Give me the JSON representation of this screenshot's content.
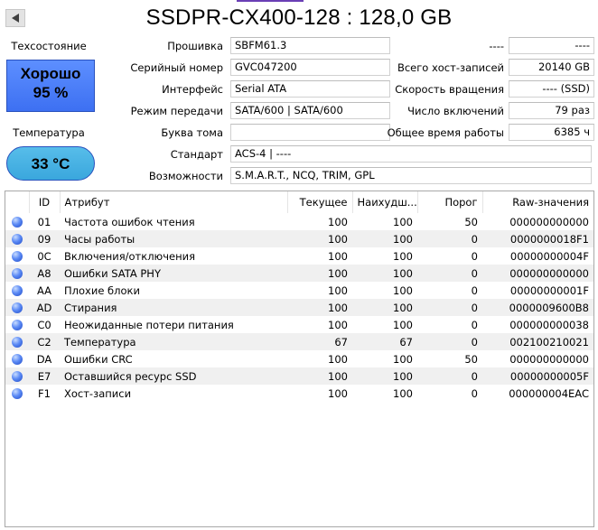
{
  "title": "SSDPR-CX400-128 : 128,0 GB",
  "health": {
    "label": "Техсостояние",
    "status": "Хорошо",
    "percent": "95 %",
    "color": "#4a7df7"
  },
  "temperature": {
    "label": "Температура",
    "value": "33 °C",
    "color": "#45b0e0"
  },
  "fields_left": [
    {
      "label": "Прошивка",
      "value": "SBFM61.3"
    },
    {
      "label": "Серийный номер",
      "value": "GVC047200"
    },
    {
      "label": "Интерфейс",
      "value": "Serial ATA"
    },
    {
      "label": "Режим передачи",
      "value": "SATA/600 | SATA/600"
    },
    {
      "label": "Буква тома",
      "value": ""
    },
    {
      "label": "Стандарт",
      "value": "ACS-4 | ----"
    },
    {
      "label": "Возможности",
      "value": "S.M.A.R.T., NCQ, TRIM, GPL"
    }
  ],
  "fields_right": [
    {
      "label": "----",
      "value": "----"
    },
    {
      "label": "Всего хост-записей",
      "value": "20140 GB"
    },
    {
      "label": "Скорость вращения",
      "value": "---- (SSD)"
    },
    {
      "label": "Число включений",
      "value": "79 раз"
    },
    {
      "label": "Общее время работы",
      "value": "6385 ч"
    }
  ],
  "smart": {
    "headers": [
      "",
      "ID",
      "Атрибут",
      "Текущее",
      "Наихудш...",
      "Порог",
      "Raw-значения"
    ],
    "rows": [
      [
        "01",
        "Частота ошибок чтения",
        "100",
        "100",
        "50",
        "000000000000"
      ],
      [
        "09",
        "Часы работы",
        "100",
        "100",
        "0",
        "0000000018F1"
      ],
      [
        "0C",
        "Включения/отключения",
        "100",
        "100",
        "0",
        "00000000004F"
      ],
      [
        "A8",
        "Ошибки SATA PHY",
        "100",
        "100",
        "0",
        "000000000000"
      ],
      [
        "AA",
        "Плохие блоки",
        "100",
        "100",
        "0",
        "00000000001F"
      ],
      [
        "AD",
        "Стирания",
        "100",
        "100",
        "0",
        "0000009600B8"
      ],
      [
        "C0",
        "Неожиданные потери питания",
        "100",
        "100",
        "0",
        "000000000038"
      ],
      [
        "C2",
        "Температура",
        "67",
        "67",
        "0",
        "002100210021"
      ],
      [
        "DA",
        "Ошибки CRC",
        "100",
        "100",
        "50",
        "000000000000"
      ],
      [
        "E7",
        "Оставшийся ресурс SSD",
        "100",
        "100",
        "0",
        "00000000005F"
      ],
      [
        "F1",
        "Хост-записи",
        "100",
        "100",
        "0",
        "000000004EAC"
      ]
    ]
  }
}
